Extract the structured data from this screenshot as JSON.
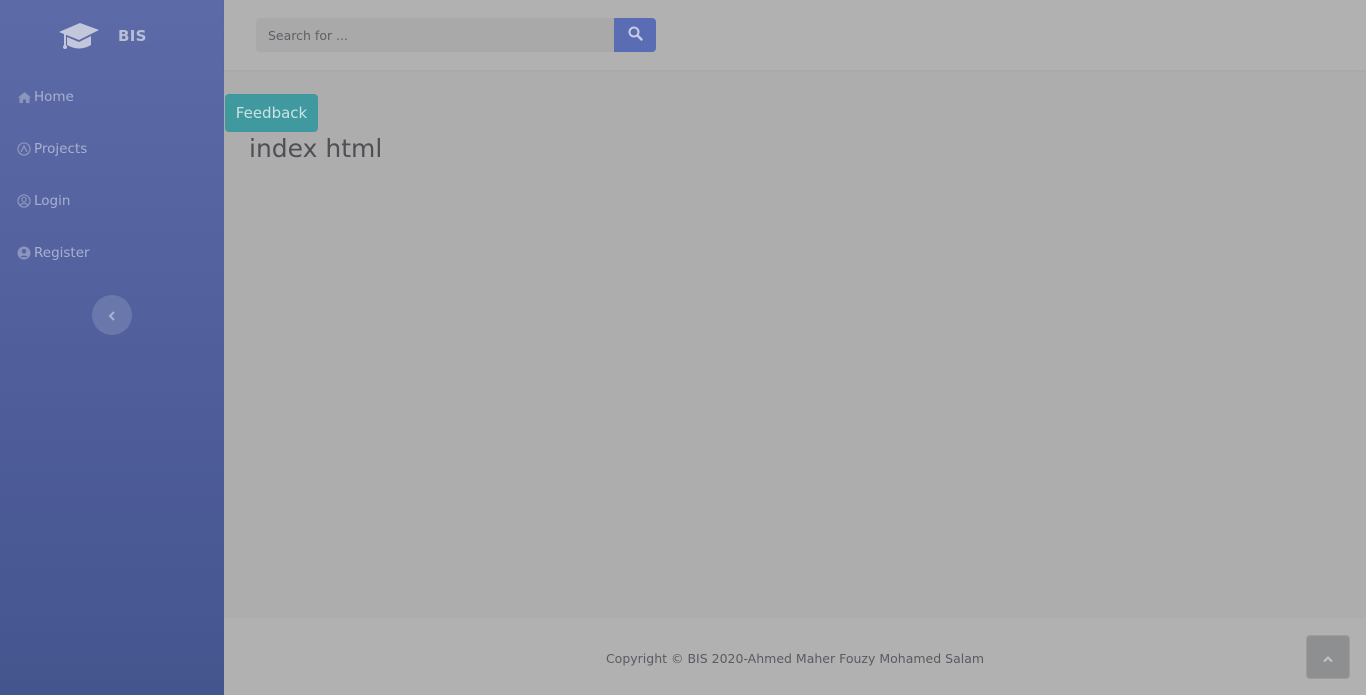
{
  "brand": {
    "name": "BIS",
    "icon": "graduation-cap-icon"
  },
  "sidebar": {
    "items": [
      {
        "label": "Home",
        "icon": "home-icon"
      },
      {
        "label": "Projects",
        "icon": "projects-icon"
      },
      {
        "label": "Login",
        "icon": "user-circle-icon"
      },
      {
        "label": "Register",
        "icon": "user-icon"
      }
    ],
    "collapse_icon": "chevron-left-icon"
  },
  "search": {
    "placeholder": "Search for ...",
    "value": "",
    "button_icon": "search-icon"
  },
  "main": {
    "feedback_label": "Feedback",
    "heading": "index html"
  },
  "footer": {
    "copyright": "Copyright © BIS 2020-Ahmed Maher Fouzy Mohamed Salam",
    "scroll_top_icon": "chevron-up-icon"
  },
  "colors": {
    "sidebar_top": "#5c6aa8",
    "sidebar_bottom": "#44558e",
    "accent": "#5a6cb3",
    "feedback": "#3f999e",
    "overlay_background": "#adadae"
  }
}
